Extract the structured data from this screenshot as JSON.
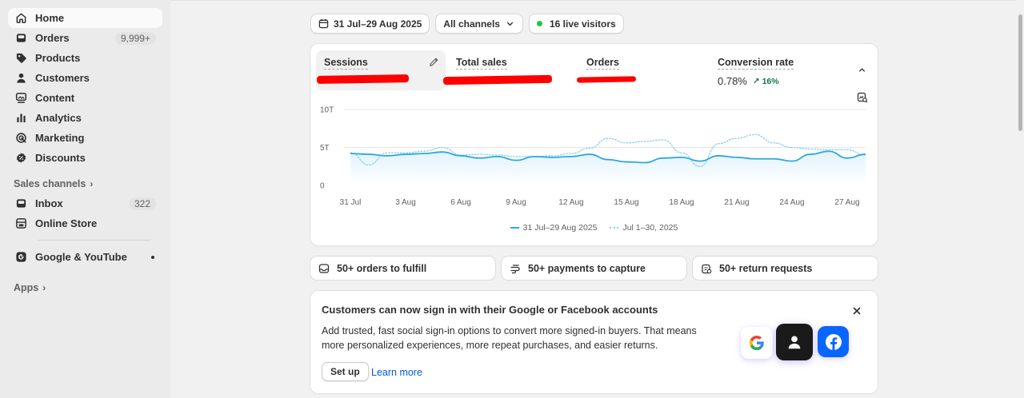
{
  "sidebar": {
    "items": [
      {
        "label": "Home",
        "icon": "home-icon",
        "active": true
      },
      {
        "label": "Orders",
        "icon": "orders-icon",
        "badge": "9,999+"
      },
      {
        "label": "Products",
        "icon": "tag-icon"
      },
      {
        "label": "Customers",
        "icon": "person-icon"
      },
      {
        "label": "Content",
        "icon": "content-icon"
      },
      {
        "label": "Analytics",
        "icon": "bar-chart-icon"
      },
      {
        "label": "Marketing",
        "icon": "target-icon"
      },
      {
        "label": "Discounts",
        "icon": "discount-icon"
      }
    ],
    "sales_channels_label": "Sales channels",
    "channels": [
      {
        "label": "Inbox",
        "icon": "inbox-icon",
        "badge": "322"
      },
      {
        "label": "Online Store",
        "icon": "store-icon"
      }
    ],
    "apps_items": [
      {
        "label": "Google & YouTube",
        "icon": "google-icon"
      }
    ],
    "apps_label": "Apps"
  },
  "toolbar": {
    "date_range": "31 Jul–29 Aug 2025",
    "channels": "All channels",
    "live_visitors": "16 live visitors"
  },
  "metrics": [
    {
      "label": "Sessions",
      "value": "",
      "redacted": true
    },
    {
      "label": "Total sales",
      "value": "",
      "redacted": true
    },
    {
      "label": "Orders",
      "value": "",
      "redacted": true
    },
    {
      "label": "Conversion rate",
      "value": "0.78%",
      "trend": "16%"
    }
  ],
  "chart_data": {
    "type": "line",
    "y_ticks": [
      "10T",
      "5T",
      "0"
    ],
    "ylim": [
      0,
      10
    ],
    "x_ticks": [
      "31 Jul",
      "3 Aug",
      "6 Aug",
      "9 Aug",
      "12 Aug",
      "15 Aug",
      "18 Aug",
      "21 Aug",
      "24 Aug",
      "27 Aug"
    ],
    "series": [
      {
        "name": "31 Jul–29 Aug 2025",
        "color": "#2ea7e0",
        "style": "solid",
        "values": [
          4.2,
          4.1,
          3.9,
          4.1,
          4.2,
          4.4,
          3.9,
          3.6,
          3.8,
          3.3,
          3.8,
          3.7,
          3.8,
          4.1,
          3.4,
          3.1,
          3.0,
          3.6,
          3.7,
          3.2,
          3.9,
          3.7,
          3.5,
          3.5,
          3.2,
          4.1,
          4.5,
          3.6,
          4.1
        ]
      },
      {
        "name": "Jul 1–30, 2025",
        "color": "#8fd2ee",
        "style": "dotted",
        "values": [
          4.3,
          2.7,
          4.3,
          4.3,
          4.5,
          5.0,
          4.0,
          4.1,
          4.0,
          3.8,
          3.8,
          3.9,
          4.2,
          4.9,
          6.2,
          5.6,
          5.8,
          6.0,
          4.3,
          2.5,
          5.5,
          6.2,
          6.7,
          5.6,
          5.0,
          4.8,
          4.7,
          4.7,
          4.0
        ]
      }
    ]
  },
  "tasks": [
    {
      "label": "50+ orders to fulfill",
      "icon": "orders-icon"
    },
    {
      "label": "50+ payments to capture",
      "icon": "payment-icon"
    },
    {
      "label": "50+ return requests",
      "icon": "return-icon"
    }
  ],
  "promo": {
    "title": "Customers can now sign in with their Google or Facebook accounts",
    "body": "Add trusted, fast social sign-in options to convert more signed-in buyers. That means more personalized experiences, more repeat purchases, and easier returns.",
    "setup_label": "Set up",
    "learn_more_label": "Learn more"
  }
}
